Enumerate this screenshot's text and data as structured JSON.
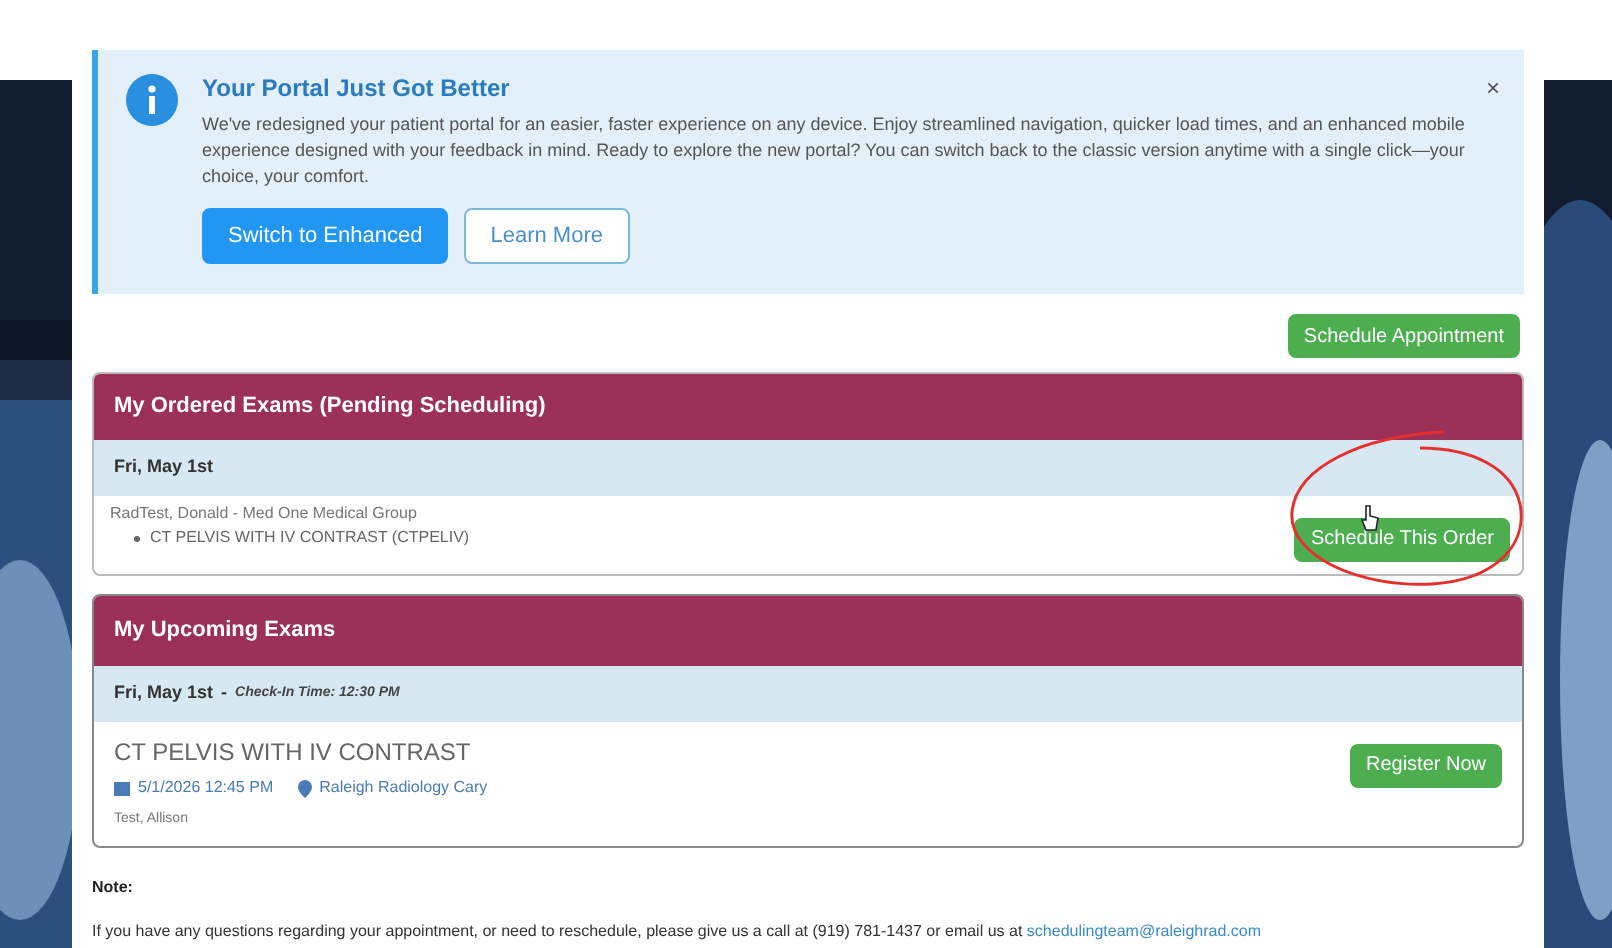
{
  "banner": {
    "title": "Your Portal Just Got Better",
    "message": "We've redesigned your patient portal for an easier, faster experience on any device. Enjoy streamlined navigation, quicker load times, and an enhanced mobile experience designed with your feedback in mind. Ready to explore the new portal? You can switch back to the classic version anytime with a single click—your choice, your comfort.",
    "close": "×",
    "buttons": [
      {
        "label": "Switch to Enhanced",
        "kind": "primary"
      },
      {
        "label": "Learn More",
        "kind": "outline"
      }
    ]
  },
  "schedule_button": "Schedule Appointment",
  "ordered_exams": {
    "title": "My Ordered Exams (Pending Scheduling)",
    "date": "Fri, May 1st",
    "orders": [
      {
        "provider": "RadTest, Donald - Med One Medical Group",
        "exam": "CT PELVIS WITH IV CONTRAST (CTPELIV)",
        "button": "Schedule This Order"
      }
    ]
  },
  "upcoming_exams": {
    "title": "My Upcoming Exams",
    "date": "Fri, May 1st",
    "separator": "-",
    "checkin": "Check-In Time: 12:30 PM",
    "exams": [
      {
        "name": "CT PELVIS WITH IV CONTRAST",
        "datetime": "5/1/2026 12:45 PM",
        "location": "Raleigh Radiology Cary",
        "patient": "Test, Allison",
        "button": "Register Now"
      }
    ]
  },
  "note": {
    "label": "Note:",
    "text": "If you have any questions regarding your appointment, or need to reschedule, please give us a call at (919) 781-1437 or email us at",
    "email": "schedulingteam@raleighrad.com"
  }
}
